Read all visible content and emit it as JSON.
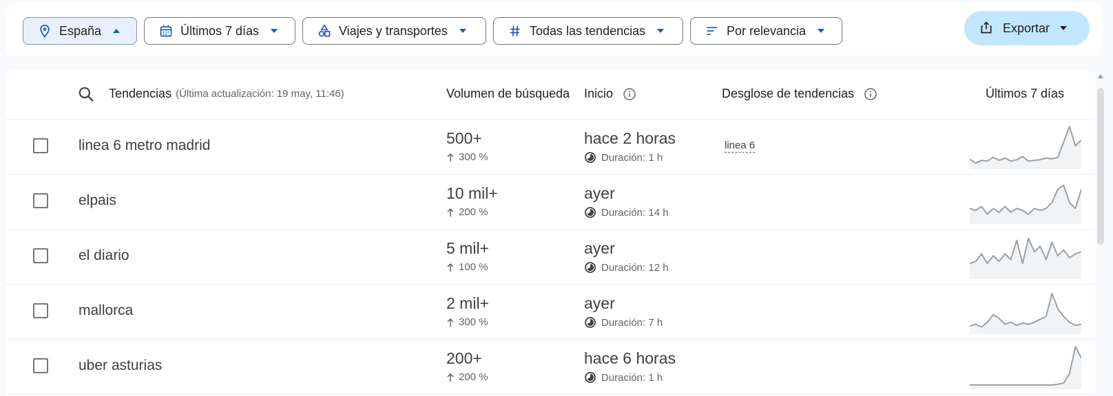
{
  "filters": {
    "location": {
      "label": "España",
      "icon": "location-pin-icon"
    },
    "period": {
      "label": "Últimos 7 días",
      "icon": "calendar-icon"
    },
    "category": {
      "label": "Viajes y transportes",
      "icon": "category-shapes-icon"
    },
    "trend_type": {
      "label": "Todas las tendencias",
      "icon": "hash-icon"
    },
    "sort": {
      "label": "Por relevancia",
      "icon": "sort-lines-icon"
    },
    "export": {
      "label": "Exportar",
      "icon": "share-export-icon"
    }
  },
  "header": {
    "trends": "Tendencias",
    "last_update": "(Última actualización: 19 may, 11:46)",
    "volume": "Volumen de búsqueda",
    "start": "Inicio",
    "breakdown": "Desglose de tendencias",
    "last7": "Últimos 7 días"
  },
  "rows": [
    {
      "term": "linea 6 metro madrid",
      "volume": "500+",
      "change": "300 %",
      "started": "hace 2 horas",
      "duration": "Duración: 1 h",
      "breakdown": "linea 6",
      "trend": [
        0.15,
        0.05,
        0.12,
        0.1,
        0.2,
        0.12,
        0.18,
        0.1,
        0.14,
        0.22,
        0.1,
        0.12,
        0.14,
        0.18,
        0.16,
        0.2,
        0.6,
        1.0,
        0.5,
        0.65
      ]
    },
    {
      "term": "elpais",
      "volume": "10 mil+",
      "change": "200 %",
      "started": "ayer",
      "duration": "Duración: 14 h",
      "breakdown": "",
      "trend": [
        0.3,
        0.25,
        0.35,
        0.15,
        0.3,
        0.2,
        0.35,
        0.2,
        0.3,
        0.25,
        0.15,
        0.3,
        0.25,
        0.3,
        0.45,
        0.8,
        0.9,
        0.45,
        0.3,
        0.8
      ]
    },
    {
      "term": "el diario",
      "volume": "5 mil+",
      "change": "100 %",
      "started": "ayer",
      "duration": "Duración: 12 h",
      "breakdown": "",
      "trend": [
        0.3,
        0.35,
        0.55,
        0.3,
        0.5,
        0.35,
        0.55,
        0.4,
        0.9,
        0.3,
        0.95,
        0.6,
        0.75,
        0.4,
        0.85,
        0.5,
        0.65,
        0.45,
        0.55,
        0.6
      ]
    },
    {
      "term": "mallorca",
      "volume": "2 mil+",
      "change": "300 %",
      "started": "ayer",
      "duration": "Duración: 7 h",
      "breakdown": "",
      "trend": [
        0.1,
        0.15,
        0.08,
        0.2,
        0.4,
        0.3,
        0.15,
        0.2,
        0.12,
        0.18,
        0.15,
        0.2,
        0.28,
        0.35,
        0.95,
        0.55,
        0.35,
        0.2,
        0.12,
        0.15
      ]
    },
    {
      "term": "uber asturias",
      "volume": "200+",
      "change": "200 %",
      "started": "hace 6 horas",
      "duration": "Duración: 1 h",
      "breakdown": "",
      "trend": [
        0.0,
        0.0,
        0.0,
        0.0,
        0.0,
        0.0,
        0.0,
        0.0,
        0.0,
        0.0,
        0.0,
        0.0,
        0.0,
        0.0,
        0.0,
        0.02,
        0.05,
        0.3,
        1.0,
        0.7
      ]
    }
  ]
}
